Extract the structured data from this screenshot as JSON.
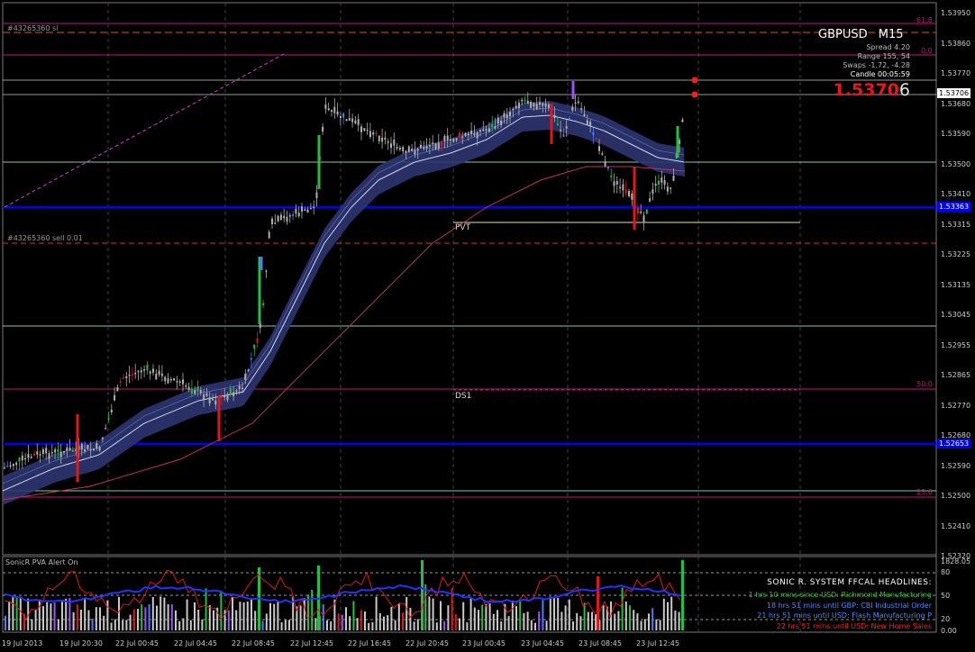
{
  "header": {
    "symbol": "GBPUSD",
    "timeframe": "M15"
  },
  "info": {
    "spread": "Spread   4.20",
    "range": "Range   155, 54",
    "swaps": "Swaps   -1.72, -4.28",
    "candle": "Candle   00:05:59",
    "price_main": "1.5370",
    "price_last_digit": "6"
  },
  "orders": {
    "sl_label": "#43265360 sl",
    "sell_label": "#43265360 sell 0.01"
  },
  "levels": {
    "fib_618": "61.8",
    "fib_0": "0.0",
    "fib_50": "50.0",
    "fib_236": "23.6",
    "pvt": "PVT",
    "ds1": "DS1"
  },
  "price_axis": {
    "ticks": [
      "1.53950",
      "1.53860",
      "1.53770",
      "1.53680",
      "1.53590",
      "1.53500",
      "1.53410",
      "1.53315",
      "1.53225",
      "1.53135",
      "1.53045",
      "1.52955",
      "1.52865",
      "1.52770",
      "1.52680",
      "1.52590",
      "1.52500",
      "1.52410",
      "1.52320"
    ],
    "current_price_box": "1.53706",
    "blue_upper_box": "1.53363",
    "blue_lower_box": "1.52653"
  },
  "time_axis": {
    "ticks": [
      "19 Jul 2013",
      "19 Jul 20:30",
      "22 Jul 00:45",
      "22 Jul 04:45",
      "22 Jul 08:45",
      "22 Jul 12:45",
      "22 Jul 16:45",
      "22 Jul 20:45",
      "23 Jul 00:45",
      "23 Jul 04:45",
      "23 Jul 08:45",
      "23 Jul 12:45"
    ]
  },
  "sub_window": {
    "title": "SonicR PVA    Alert On",
    "axis": [
      "1828.05",
      "80",
      "50",
      "20",
      "0.00"
    ]
  },
  "ffcal": {
    "title": "SONIC R. SYSTEM  FFCAL HEADLINES:",
    "lines": [
      {
        "text": "1 hrs 10 mins since USD: Richmond Manufacturing",
        "color": "#30c030"
      },
      {
        "text": "18 hrs 51 mins until GBP: CBI Industrial Order",
        "color": "#4a8cff"
      },
      {
        "text": "21 hrs 51 mins until USD: Flash Manufacturing P",
        "color": "#4a8cff"
      },
      {
        "text": "22 hrs 51 mins until USD: New Home Sales",
        "color": "#ff2020"
      }
    ]
  },
  "colors": {
    "bull_candle": "#b0b0b0",
    "green_bar": "#22c040",
    "red_bar": "#e01818",
    "blue_bar": "#4a7cff",
    "violet_bar": "#a050ff",
    "band": "#2c3570",
    "blue_level": "#0000ff",
    "fib": "#c2187a"
  }
}
